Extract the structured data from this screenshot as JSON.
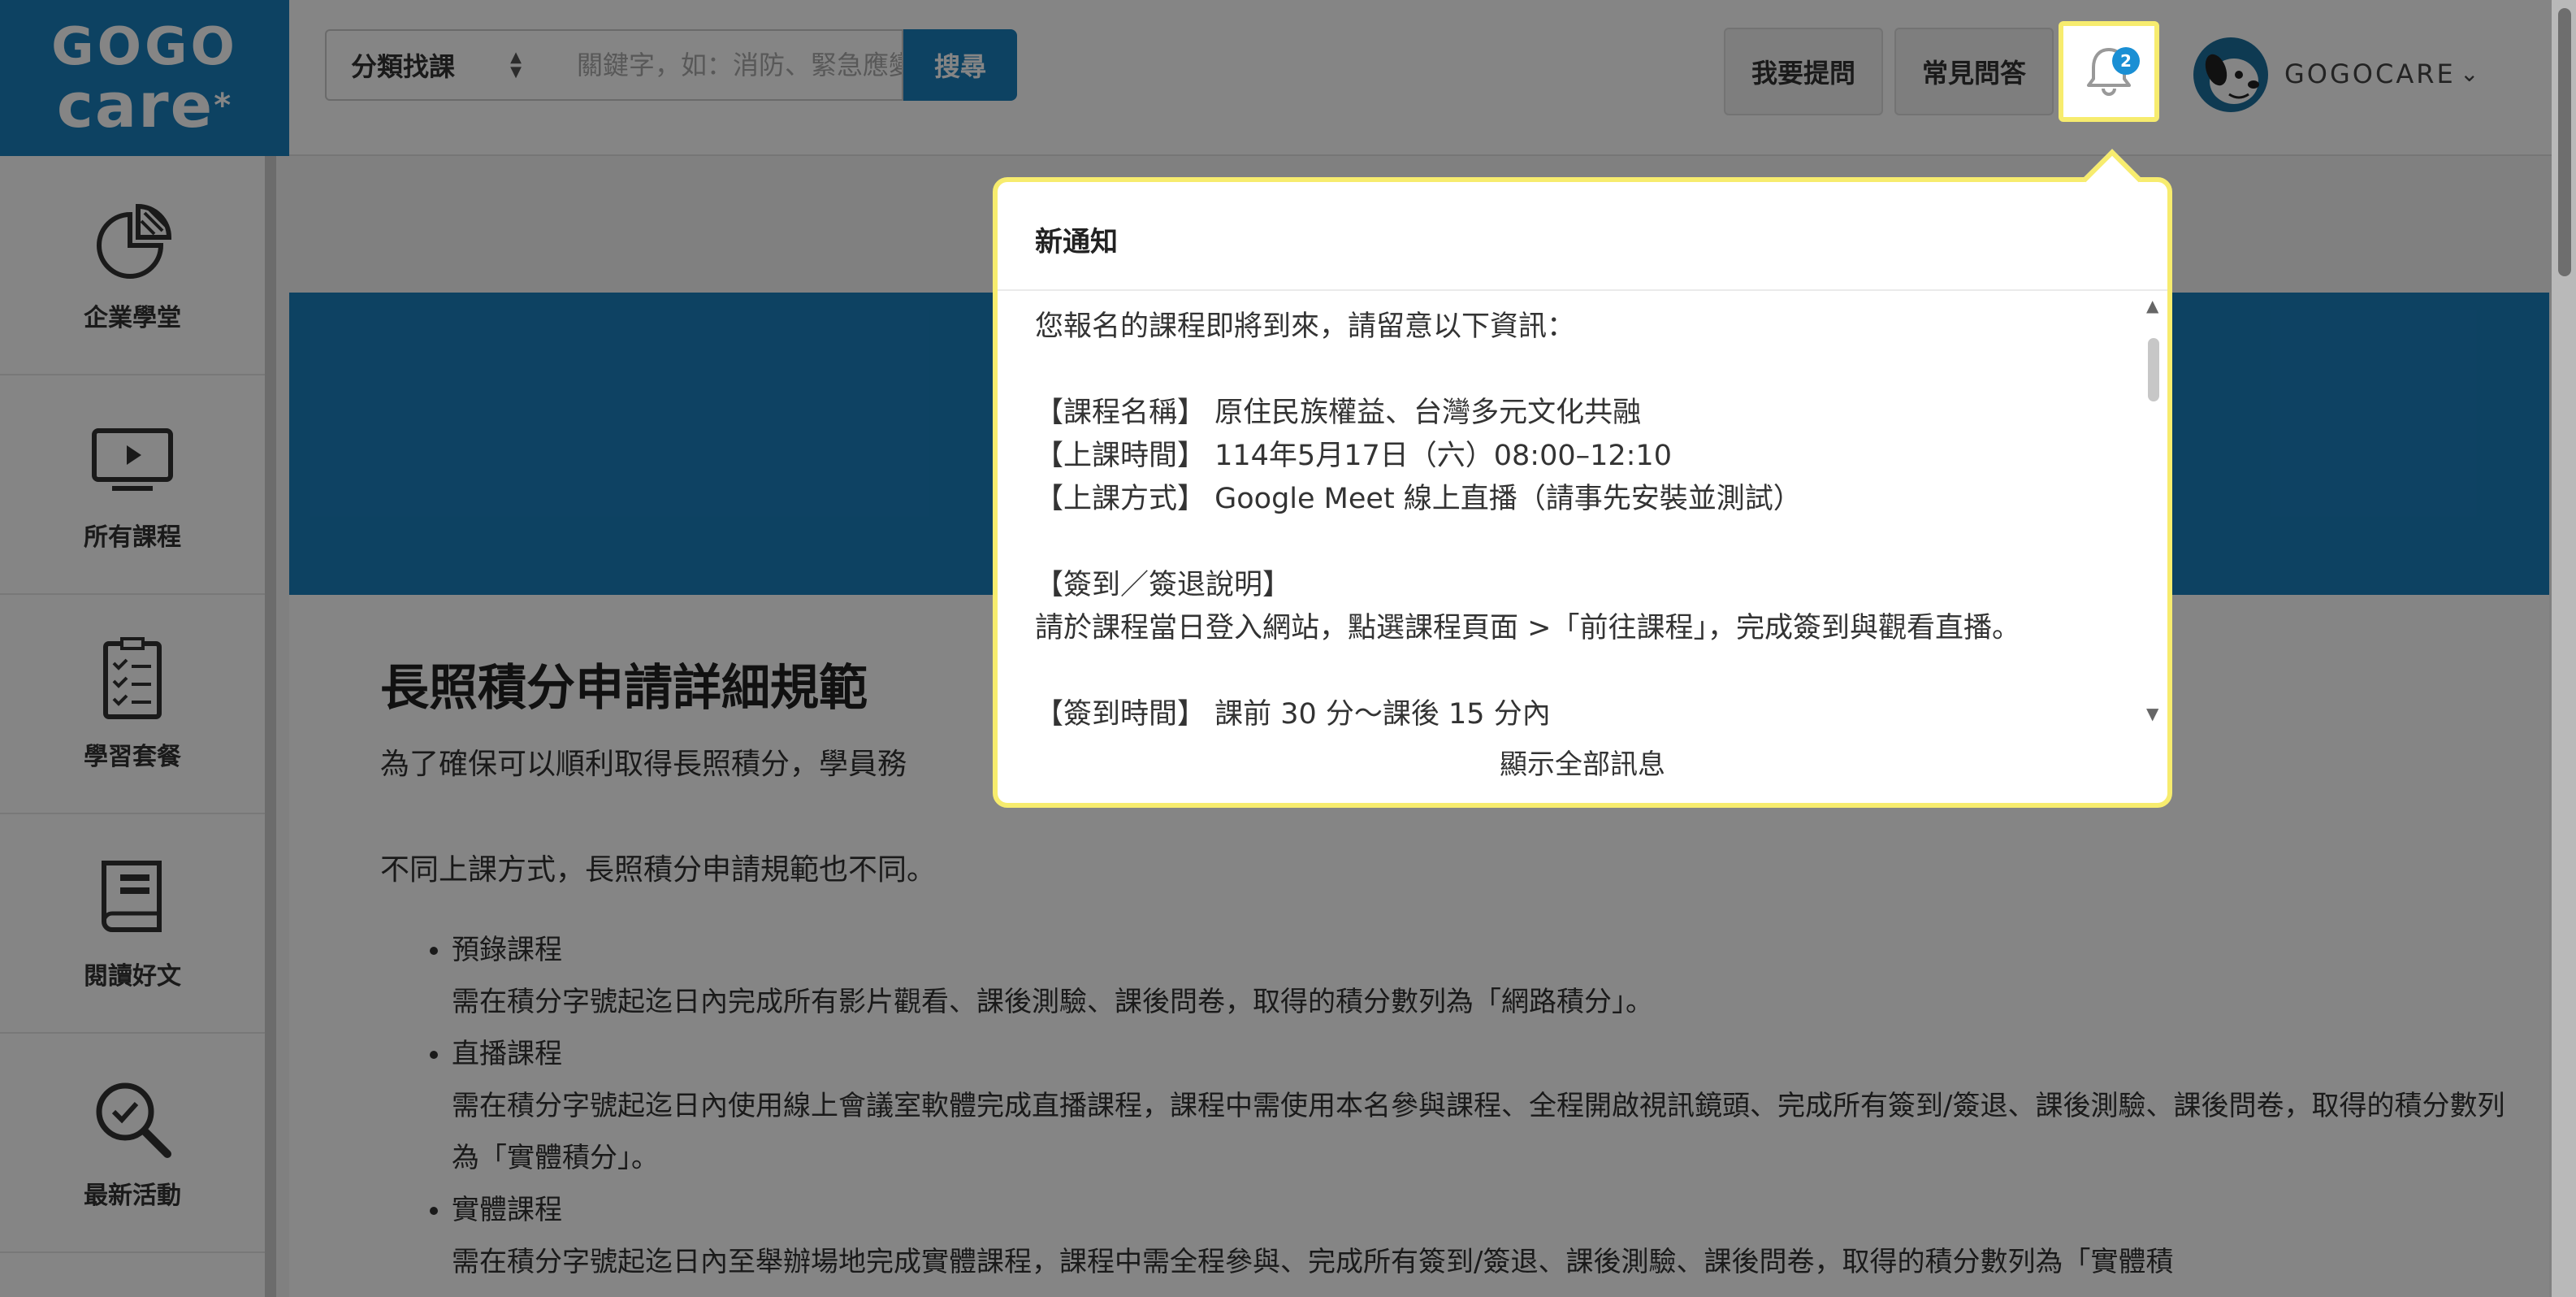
{
  "logo": {
    "line1": "GOGO",
    "line2": "care",
    "mark": "*"
  },
  "search": {
    "category_label": "分類找課",
    "placeholder": "關鍵字，如：消防、緊急應變",
    "button_label": "搜尋"
  },
  "header": {
    "ask_label": "我要提問",
    "faq_label": "常見問答",
    "notification_count": "2",
    "user_name": "GOGOCARE"
  },
  "sidebar": {
    "items": [
      {
        "label": "企業學堂",
        "icon": "pie-chart-icon"
      },
      {
        "label": "所有課程",
        "icon": "monitor-play-icon"
      },
      {
        "label": "學習套餐",
        "icon": "checklist-icon"
      },
      {
        "label": "閱讀好文",
        "icon": "book-icon"
      },
      {
        "label": "最新活動",
        "icon": "magnifier-check-icon"
      }
    ]
  },
  "content": {
    "title": "長照積分申請詳細規範",
    "intro": "為了確保可以順利取得長照積分，學員務",
    "lead": "不同上課方式，長照積分申請規範也不同。",
    "items": [
      {
        "heading": "預錄課程",
        "desc": "需在積分字號起迄日內完成所有影片觀看、課後測驗、課後問卷，取得的積分數列為「網路積分」。"
      },
      {
        "heading": "直播課程",
        "desc": "需在積分字號起迄日內使用線上會議室軟體完成直播課程，課程中需使用本名參與課程、全程開啟視訊鏡頭、完成所有簽到/簽退、課後測驗、課後問卷，取得的積分數列為「實體積分」。"
      },
      {
        "heading": "實體課程",
        "desc": "需在積分字號起迄日內至舉辦場地完成實體課程，課程中需全程參與、完成所有簽到/簽退、課後測驗、課後問卷，取得的積分數列為「實體積"
      }
    ]
  },
  "notification": {
    "title": "新通知",
    "body": "您報名的課程即將到來，請留意以下資訊：\n\n【課程名稱】 原住民族權益、台灣多元文化共融\n【上課時間】 114年5月17日（六）08:00–12:10\n【上課方式】 Google Meet 線上直播（請事先安裝並測試）\n\n【簽到／簽退說明】\n請於課程當日登入網站，點選課程頁面 >「前往課程」，完成簽到與觀看直播。\n\n【簽到時間】 課前 30 分～課後 15 分內",
    "footer_link": "顯示全部訊息"
  },
  "colors": {
    "brand": "#1a7fbd",
    "highlight": "#f7ec6e",
    "badge": "#1a8fd4"
  }
}
